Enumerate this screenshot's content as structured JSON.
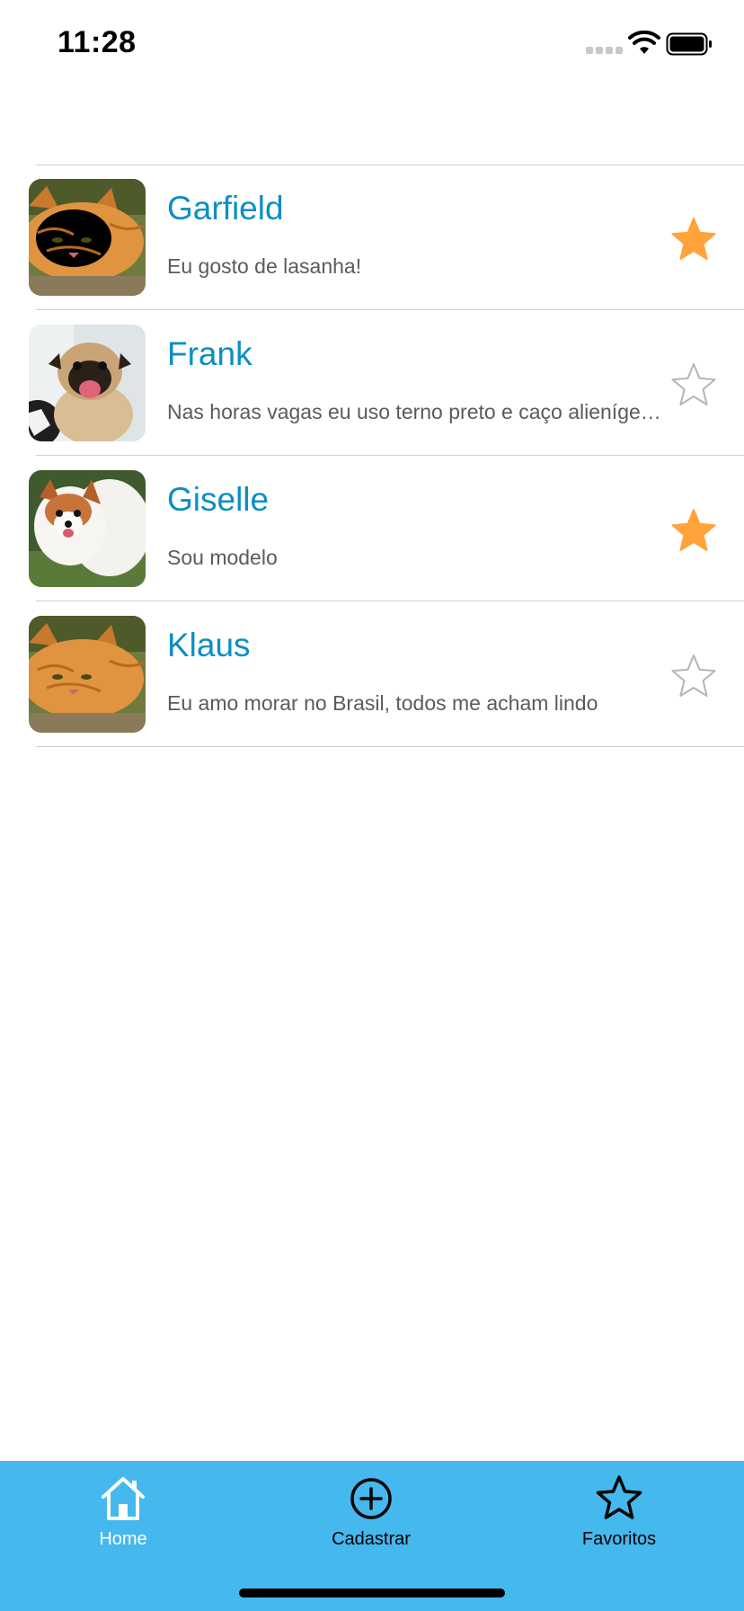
{
  "status_bar": {
    "time": "11:28",
    "icons": [
      "cellular-signal-icon",
      "wifi-icon",
      "battery-icon"
    ]
  },
  "pets": [
    {
      "name": "Garfield",
      "description": "Eu gosto de lasanha!",
      "favorite": true,
      "photo": "orange-cat-photo"
    },
    {
      "name": "Frank",
      "description": "Nas horas vagas eu uso terno preto e caço alienígenas",
      "favorite": false,
      "photo": "pug-photo"
    },
    {
      "name": "Giselle",
      "description": "Sou modelo",
      "favorite": true,
      "photo": "pomeranian-photo"
    },
    {
      "name": "Klaus",
      "description": "Eu amo morar no Brasil, todos me acham lindo",
      "favorite": false,
      "photo": "orange-cat-photo"
    }
  ],
  "tabbar": {
    "home_label": "Home",
    "register_label": "Cadastrar",
    "favorites_label": "Favoritos",
    "active_tab": "Home"
  },
  "colors": {
    "name_text": "#0b8fc4",
    "star_active": "#ffa33a",
    "star_inactive": "#b5b5b5",
    "tabbar_bg": "#45b8ee"
  }
}
